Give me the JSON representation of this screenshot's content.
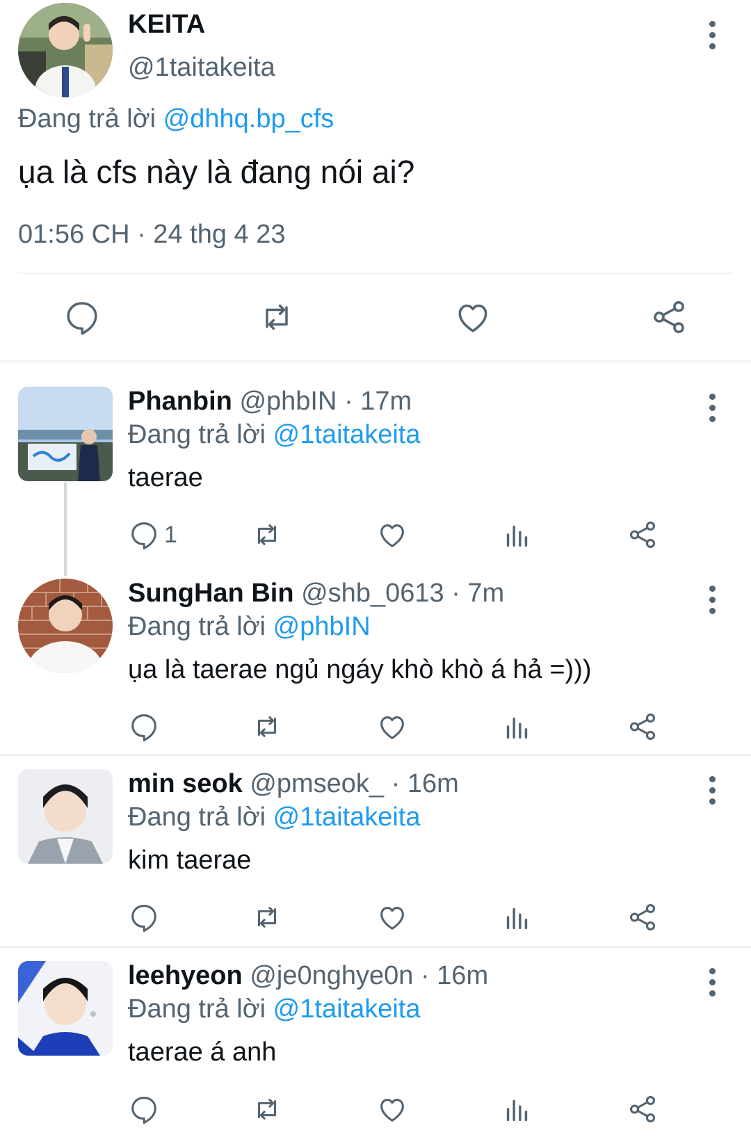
{
  "main_tweet": {
    "name": "KEITA",
    "handle": "@1taitakeita",
    "replying_prefix": "Đang trả lời",
    "replying_to": "@dhhq.bp_cfs",
    "text": "ụa là cfs này là đang nói ai?",
    "timestamp": "01:56 CH · 24 thg 4 23",
    "actions": [
      "reply-icon",
      "retweet-icon",
      "like-icon",
      "share-icon"
    ]
  },
  "replies": [
    {
      "name": "Phanbin",
      "handle": "@phbIN",
      "time": "17m",
      "replying_prefix": "Đang trả lời",
      "replying_to": "@1taitakeita",
      "text": "taerae",
      "reply_count": "1"
    },
    {
      "name": "SungHan Bin",
      "handle": "@shb_0613",
      "time": "7m",
      "replying_prefix": "Đang trả lời",
      "replying_to": "@phbIN",
      "text": "ụa là taerae ngủ ngáy khò khò á hả =)))",
      "reply_count": ""
    },
    {
      "name": "min seok",
      "handle": "@pmseok_",
      "time": "16m",
      "replying_prefix": "Đang trả lời",
      "replying_to": "@1taitakeita",
      "text": "kim taerae",
      "reply_count": ""
    },
    {
      "name": "leehyeon",
      "handle": "@je0nghye0n",
      "time": "16m",
      "replying_prefix": "Đang trả lời",
      "replying_to": "@1taitakeita",
      "text": "taerae á anh",
      "reply_count": ""
    }
  ],
  "reply_actions": [
    "reply-icon",
    "retweet-icon",
    "like-icon",
    "analytics-icon",
    "share-icon"
  ],
  "colors": {
    "text": "#0f1419",
    "secondary": "#536471",
    "link": "#1d9bf0",
    "divider": "#eff3f4"
  }
}
